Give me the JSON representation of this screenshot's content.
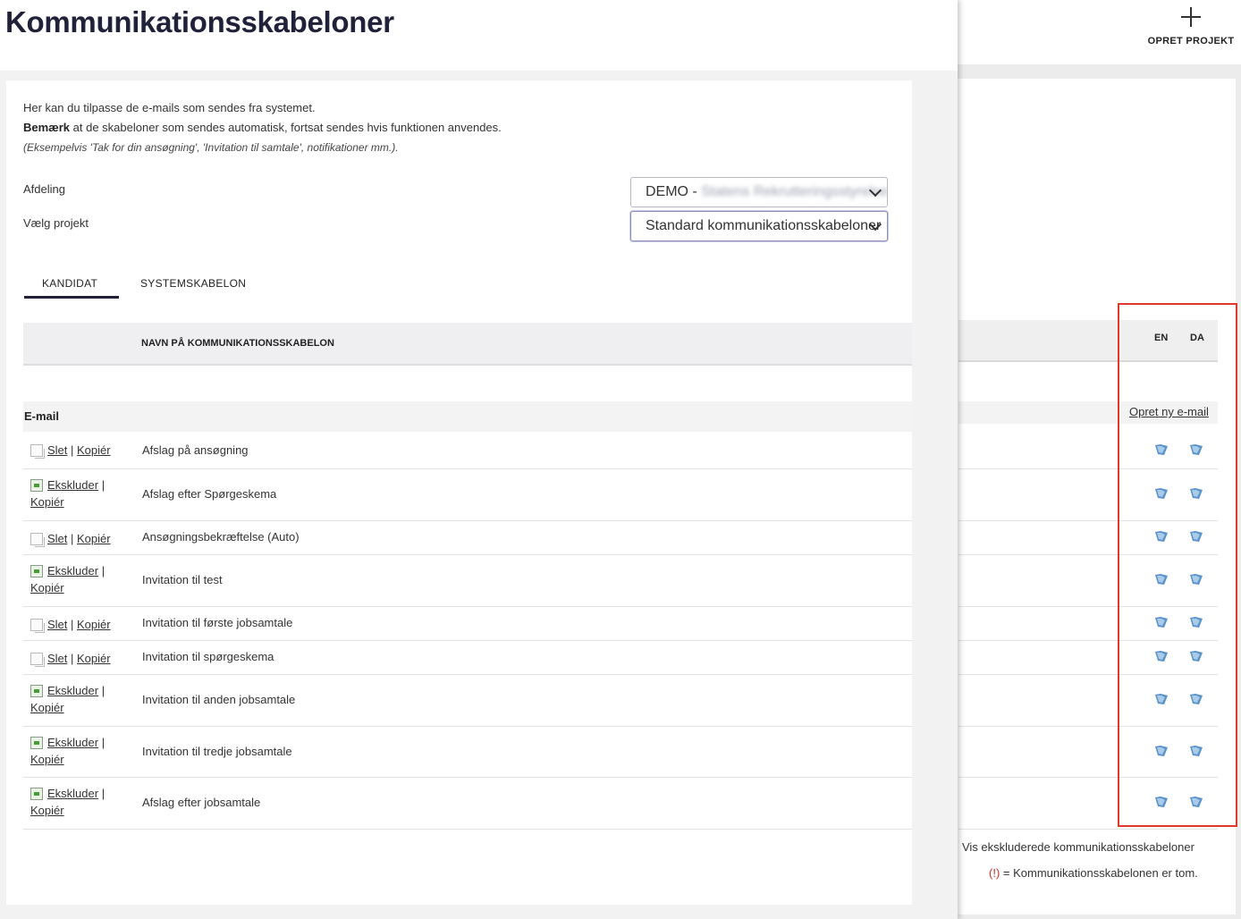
{
  "window": {
    "create_project_label": "OPRET PROJEKT",
    "columns": {
      "en": "EN",
      "da": "DA"
    },
    "new_email_label": "Opret ny e-mail",
    "show_excluded": "Vis ekskluderede kommunikationsskabeloner",
    "empty_mark": "(!)",
    "empty_legend": "= Kommunikationsskabelonen er tom."
  },
  "modal": {
    "title": "Kommunikationsskabeloner",
    "intro_line1": "Her kan du tilpasse de e-mails som sendes fra systemet.",
    "intro_bold": "Bemærk",
    "intro_line2": "at de skabeloner som sendes automatisk, fortsat sendes hvis funktionen anvendes.",
    "intro_note": "(Eksempelvis 'Tak for din ansøgning', 'Invitation til samtale', notifikationer mm.).",
    "department_label": "Afdeling",
    "department_value_prefix": "DEMO -",
    "department_value_hidden": "Statens Rekrutteringsstyrelse",
    "project_label": "Vælg projekt",
    "project_value": "Standard kommunikationsskabeloner",
    "tabs": [
      "KANDIDAT",
      "SYSTEMSKABELON"
    ],
    "table_header": "NAVN PÅ KOMMUNIKATIONSSKABELON",
    "group_label": "E-mail",
    "action_labels": {
      "delete": "Slet",
      "copy": "Kopiér",
      "exclude": "Ekskluder",
      "separator": "|"
    },
    "rows": [
      {
        "name": "Afslag på ansøgning",
        "type": "delete"
      },
      {
        "name": "Afslag efter Spørgeskema",
        "type": "exclude"
      },
      {
        "name": "Ansøgningsbekræftelse (Auto)",
        "type": "delete"
      },
      {
        "name": "Invitation til test",
        "type": "exclude"
      },
      {
        "name": "Invitation til første jobsamtale",
        "type": "delete"
      },
      {
        "name": "Invitation til spørgeskema",
        "type": "delete"
      },
      {
        "name": "Invitation til anden jobsamtale",
        "type": "exclude"
      },
      {
        "name": "Invitation til tredje jobsamtale",
        "type": "exclude"
      },
      {
        "name": "Afslag efter jobsamtale",
        "type": "exclude"
      }
    ]
  },
  "icons": {
    "language_flag": "edit-language-icon",
    "doc": "document-icon",
    "exclude": "exclude-icon"
  },
  "colors": {
    "title": "#20223a",
    "highlight_box": "#e0382b",
    "flag": "#3d7fc1"
  }
}
